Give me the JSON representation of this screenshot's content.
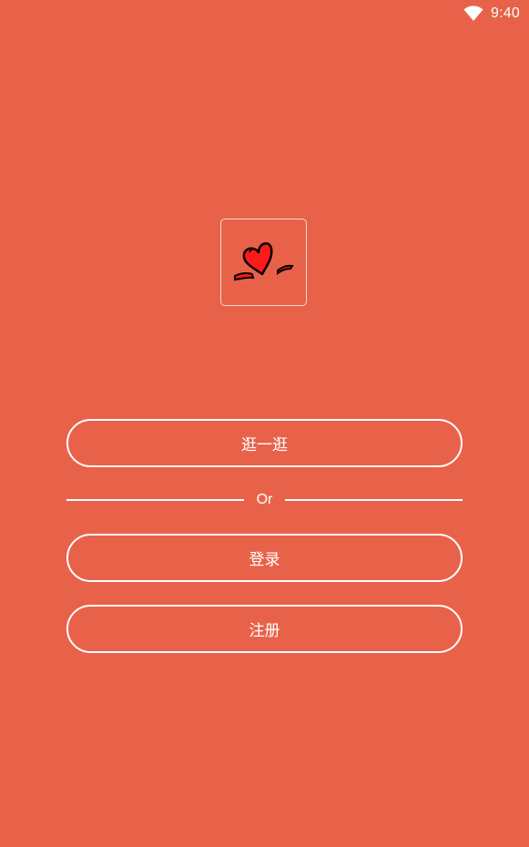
{
  "status_bar": {
    "time": "9:40",
    "wifi_icon": "wifi-icon"
  },
  "logo": {
    "icon": "heart-logo-icon"
  },
  "actions": {
    "browse_label": "逛一逛",
    "divider_text": "Or",
    "login_label": "登录",
    "register_label": "注册"
  },
  "colors": {
    "background": "#E8624A",
    "foreground": "#FFFFFF",
    "heart": "#FF1A1A"
  }
}
